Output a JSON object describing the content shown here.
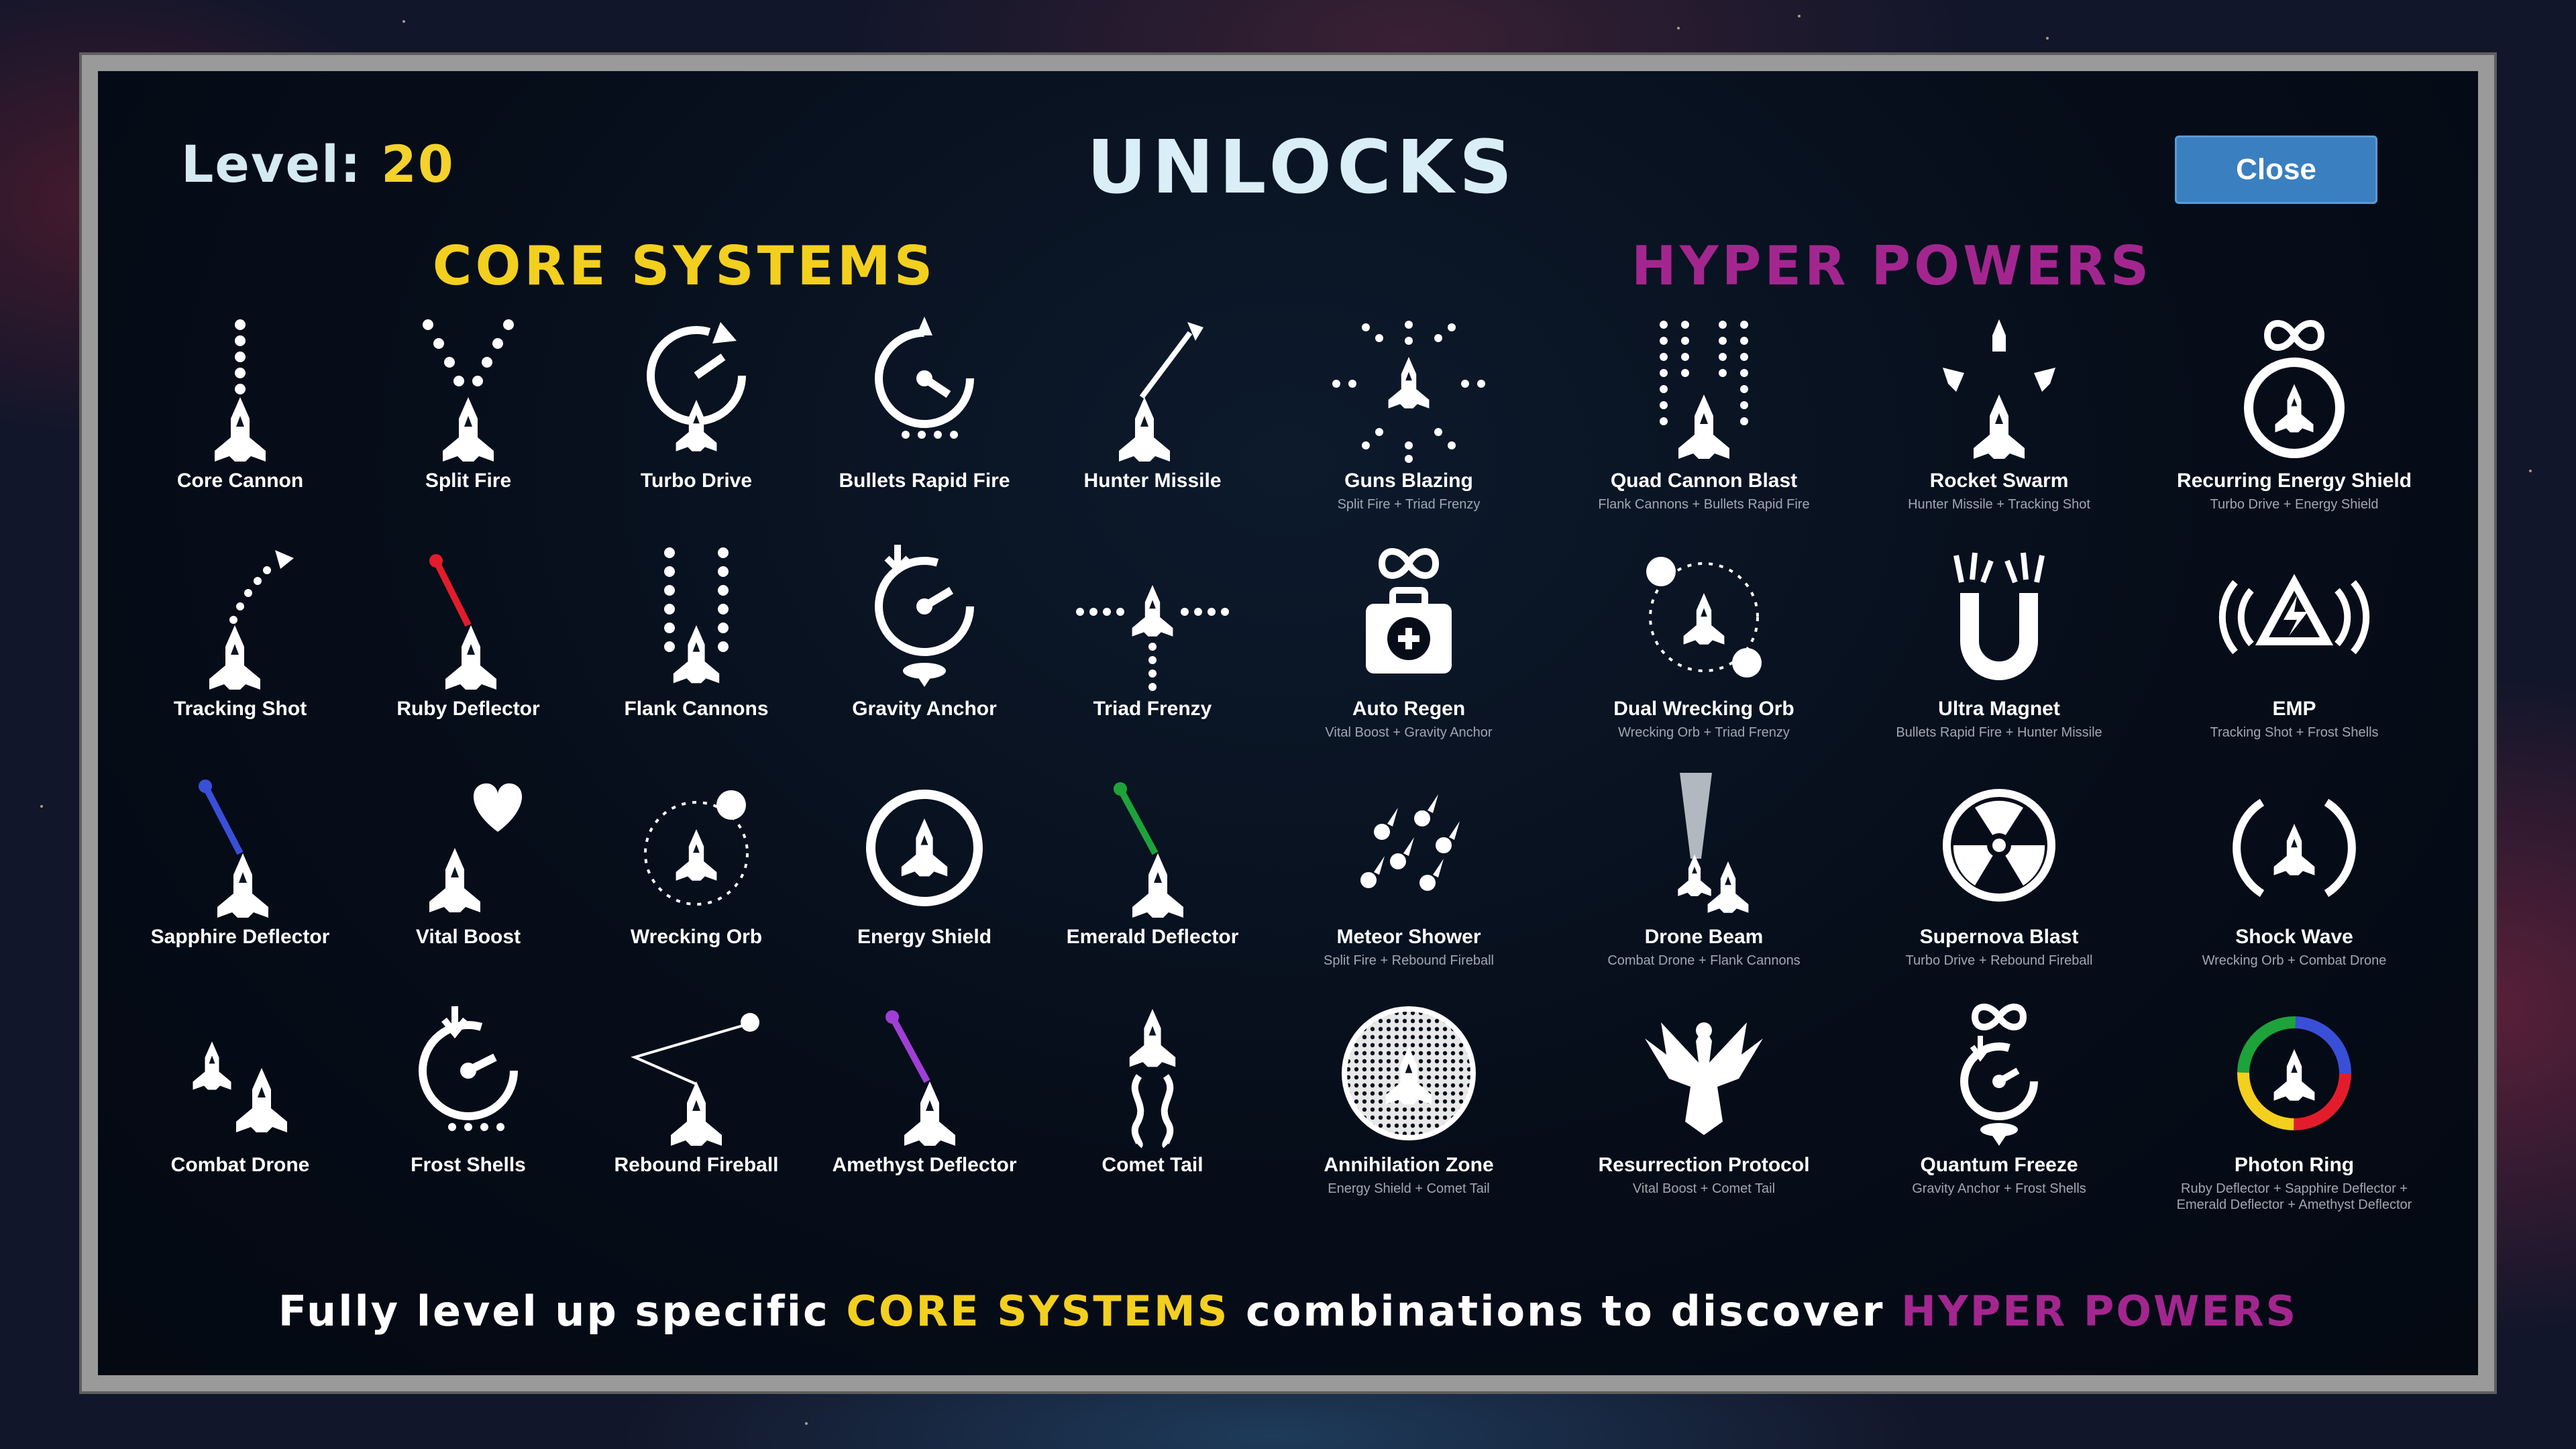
{
  "header": {
    "level_label": "Level:",
    "level_value": "20",
    "title": "UNLOCKS",
    "close_label": "Close"
  },
  "sections": {
    "core_title": "CORE SYSTEMS",
    "hyper_title": "HYPER POWERS"
  },
  "core_systems": [
    {
      "name": "Core Cannon",
      "icon": "core-cannon-icon"
    },
    {
      "name": "Split Fire",
      "icon": "split-fire-icon"
    },
    {
      "name": "Turbo Drive",
      "icon": "turbo-drive-icon"
    },
    {
      "name": "Bullets Rapid Fire",
      "icon": "bullets-rapid-fire-icon"
    },
    {
      "name": "Hunter Missile",
      "icon": "hunter-missile-icon"
    },
    {
      "name": "Tracking Shot",
      "icon": "tracking-shot-icon"
    },
    {
      "name": "Ruby Deflector",
      "icon": "ruby-deflector-icon"
    },
    {
      "name": "Flank Cannons",
      "icon": "flank-cannons-icon"
    },
    {
      "name": "Gravity Anchor",
      "icon": "gravity-anchor-icon"
    },
    {
      "name": "Triad Frenzy",
      "icon": "triad-frenzy-icon"
    },
    {
      "name": "Sapphire Deflector",
      "icon": "sapphire-deflector-icon"
    },
    {
      "name": "Vital Boost",
      "icon": "vital-boost-icon"
    },
    {
      "name": "Wrecking Orb",
      "icon": "wrecking-orb-icon"
    },
    {
      "name": "Energy Shield",
      "icon": "energy-shield-icon"
    },
    {
      "name": "Emerald Deflector",
      "icon": "emerald-deflector-icon"
    },
    {
      "name": "Combat Drone",
      "icon": "combat-drone-icon"
    },
    {
      "name": "Frost Shells",
      "icon": "frost-shells-icon"
    },
    {
      "name": "Rebound Fireball",
      "icon": "rebound-fireball-icon"
    },
    {
      "name": "Amethyst Deflector",
      "icon": "amethyst-deflector-icon"
    },
    {
      "name": "Comet Tail",
      "icon": "comet-tail-icon"
    }
  ],
  "hyper_powers": [
    {
      "name": "Guns Blazing",
      "combo": "Split Fire + Triad Frenzy",
      "icon": "guns-blazing-icon"
    },
    {
      "name": "Quad Cannon Blast",
      "combo": "Flank Cannons + Bullets Rapid Fire",
      "icon": "quad-cannon-blast-icon"
    },
    {
      "name": "Rocket Swarm",
      "combo": "Hunter Missile + Tracking Shot",
      "icon": "rocket-swarm-icon"
    },
    {
      "name": "Recurring Energy Shield",
      "combo": "Turbo Drive + Energy Shield",
      "icon": "recurring-energy-shield-icon"
    },
    {
      "name": "Auto Regen",
      "combo": "Vital Boost + Gravity Anchor",
      "icon": "auto-regen-icon"
    },
    {
      "name": "Dual Wrecking Orb",
      "combo": "Wrecking Orb + Triad Frenzy",
      "icon": "dual-wrecking-orb-icon"
    },
    {
      "name": "Ultra Magnet",
      "combo": "Bullets Rapid Fire + Hunter Missile",
      "icon": "ultra-magnet-icon"
    },
    {
      "name": "EMP",
      "combo": "Tracking Shot + Frost Shells",
      "icon": "emp-icon"
    },
    {
      "name": "Meteor Shower",
      "combo": "Split Fire + Rebound Fireball",
      "icon": "meteor-shower-icon"
    },
    {
      "name": "Drone Beam",
      "combo": "Combat Drone + Flank Cannons",
      "icon": "drone-beam-icon"
    },
    {
      "name": "Supernova Blast",
      "combo": "Turbo Drive + Rebound Fireball",
      "icon": "supernova-blast-icon"
    },
    {
      "name": "Shock Wave",
      "combo": "Wrecking Orb + Combat Drone",
      "icon": "shock-wave-icon"
    },
    {
      "name": "Annihilation Zone",
      "combo": "Energy Shield + Comet Tail",
      "icon": "annihilation-zone-icon"
    },
    {
      "name": "Resurrection Protocol",
      "combo": "Vital Boost + Comet Tail",
      "icon": "resurrection-protocol-icon"
    },
    {
      "name": "Quantum Freeze",
      "combo": "Gravity Anchor + Frost Shells",
      "icon": "quantum-freeze-icon"
    },
    {
      "name": "Photon Ring",
      "combo": "Ruby Deflector + Sapphire Deflector + Emerald Deflector + Amethyst Deflector",
      "icon": "photon-ring-icon"
    }
  ],
  "footer": {
    "prefix": "Fully level up specific ",
    "core": "CORE SYSTEMS",
    "middle": " combinations to discover ",
    "hyper": "HYPER POWERS"
  },
  "colors": {
    "core": "#f3cf1e",
    "hyper": "#a3268f",
    "close_button": "#3a7fc0",
    "level_value": "#f3d22c"
  }
}
